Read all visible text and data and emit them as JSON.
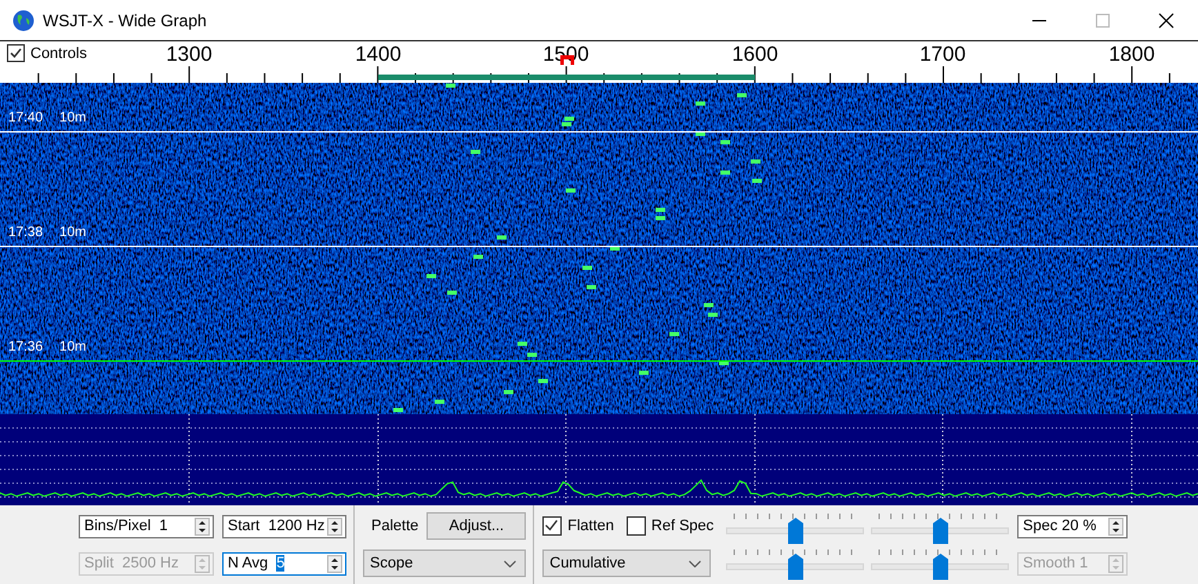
{
  "window": {
    "title": "WSJT-X - Wide Graph"
  },
  "controls_toggle": {
    "label": "Controls",
    "checked": true
  },
  "scale": {
    "labels": [
      "1300",
      "1400",
      "1500",
      "1600",
      "1700",
      "1800"
    ]
  },
  "waterfall": {
    "time_marks": [
      {
        "time": "17:40",
        "band": "10m",
        "color": "#ffffff"
      },
      {
        "time": "17:38",
        "band": "10m",
        "color": "#ffffff"
      },
      {
        "time": "17:36",
        "band": "10m",
        "color": "#00ff00"
      }
    ]
  },
  "left_spinboxes": [
    {
      "label": "Bins/Pixel",
      "value": "1",
      "disabled": false,
      "focused": false
    },
    {
      "label": "Start",
      "value": "1200 Hz",
      "disabled": false,
      "focused": false
    },
    {
      "label": "Split",
      "value": "2500  Hz",
      "disabled": true,
      "focused": false
    },
    {
      "label": "N Avg",
      "value": "5",
      "disabled": false,
      "focused": true
    }
  ],
  "palette": {
    "label": "Palette",
    "button": "Adjust...",
    "combo": "Scope"
  },
  "checkboxes": [
    {
      "label": "Flatten",
      "checked": true
    },
    {
      "label": "Ref Spec",
      "checked": false
    }
  ],
  "spectrum_combo": "Cumulative",
  "sliders": [
    {
      "level": 0.5
    },
    {
      "level": 0.5
    },
    {
      "level": 0.5
    },
    {
      "level": 0.5
    }
  ],
  "right_spinboxes": [
    {
      "label": "Spec",
      "value": "20 %",
      "disabled": false,
      "focused": false
    },
    {
      "label": "Smooth",
      "value": "1",
      "disabled": true,
      "focused": false
    }
  ]
}
